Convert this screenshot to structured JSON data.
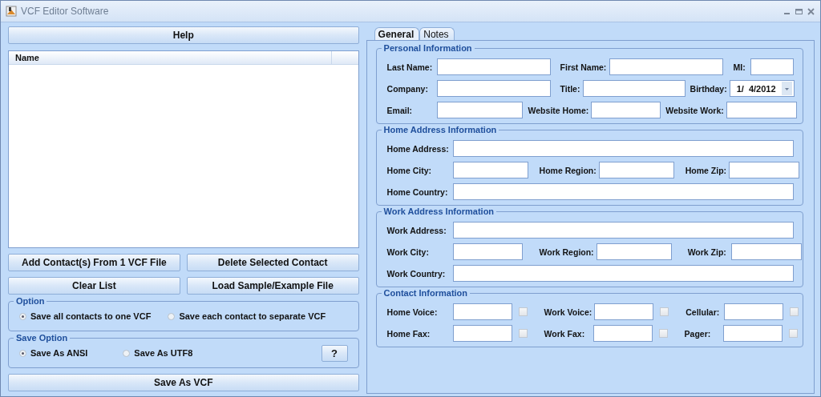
{
  "window": {
    "title": "VCF Editor Software"
  },
  "help_button": "Help",
  "contacts_list": {
    "columns": [
      "Name"
    ]
  },
  "buttons": [
    "Add Contact(s) From 1 VCF File",
    "Delete Selected Contact",
    "Clear List",
    "Load Sample/Example File"
  ],
  "option": {
    "title": "Option",
    "choices": [
      {
        "label": "Save all contacts to one VCF",
        "selected": true
      },
      {
        "label": "Save each contact to separate VCF",
        "selected": false
      }
    ]
  },
  "save_option": {
    "title": "Save Option",
    "choices": [
      {
        "label": "Save As ANSI",
        "selected": true
      },
      {
        "label": "Save As UTF8",
        "selected": false
      }
    ],
    "help_button": "?"
  },
  "save_button": "Save As VCF",
  "tabs": [
    {
      "label": "General",
      "selected": true
    },
    {
      "label": "Notes",
      "selected": false
    }
  ],
  "sections": [
    {
      "kind": "personal",
      "title": "Personal Information",
      "rows": [
        [
          {
            "label": "Last Name:"
          },
          {
            "label": "First Name:"
          },
          {
            "label": "MI:"
          }
        ],
        [
          {
            "label": "Company:"
          },
          {
            "label": "Title:"
          },
          {
            "label": "Birthday:",
            "kind": "date",
            "value": "1/  4/2012"
          }
        ],
        [
          {
            "label": "Email:"
          },
          {
            "label": "Website Home:"
          },
          {
            "label": "Website Work:"
          }
        ]
      ]
    },
    {
      "kind": "home",
      "title": "Home Address Information",
      "rows": [
        [
          {
            "label": "Home Address:"
          }
        ],
        [
          {
            "label": "Home City:"
          },
          {
            "label": "Home Region:"
          },
          {
            "label": "Home Zip:"
          }
        ],
        [
          {
            "label": "Home Country:"
          }
        ]
      ]
    },
    {
      "kind": "work",
      "title": "Work Address Information",
      "rows": [
        [
          {
            "label": "Work Address:"
          }
        ],
        [
          {
            "label": "Work City:"
          },
          {
            "label": "Work Region:"
          },
          {
            "label": "Work Zip:"
          }
        ],
        [
          {
            "label": "Work Country:"
          }
        ]
      ]
    },
    {
      "kind": "contact",
      "title": "Contact Information",
      "rows": [
        [
          {
            "label": "Home Voice:",
            "checked": false
          },
          {
            "label": "Work Voice:",
            "checked": false
          },
          {
            "label": "Cellular:",
            "checked": false
          }
        ],
        [
          {
            "label": "Home Fax:",
            "checked": false
          },
          {
            "label": "Work Fax:",
            "checked": false
          },
          {
            "label": "Pager:",
            "checked": false
          }
        ]
      ]
    }
  ]
}
